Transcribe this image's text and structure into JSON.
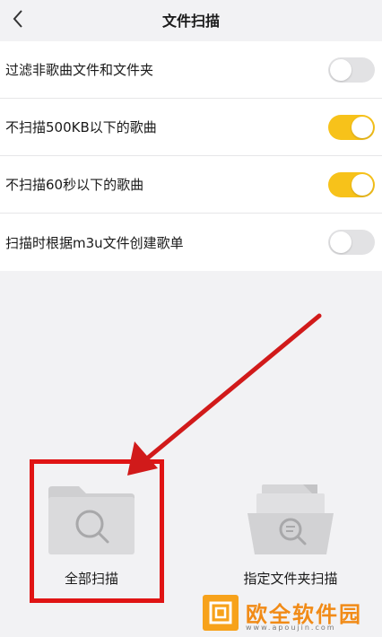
{
  "header": {
    "title": "文件扫描"
  },
  "settings": [
    {
      "label": "过滤非歌曲文件和文件夹",
      "enabled": false
    },
    {
      "label": "不扫描500KB以下的歌曲",
      "enabled": true
    },
    {
      "label": "不扫描60秒以下的歌曲",
      "enabled": true
    },
    {
      "label": "扫描时根据m3u文件创建歌单",
      "enabled": false
    }
  ],
  "scan_options": {
    "all": {
      "label": "全部扫描"
    },
    "folder": {
      "label": "指定文件夹扫描"
    }
  },
  "watermark": {
    "name": "欧全软件园",
    "url": "www.apoujin.com"
  },
  "colors": {
    "toggle_on": "#f7c21a",
    "toggle_off": "#e2e2e4",
    "highlight": "#e01414",
    "background": "#f2f2f4"
  }
}
